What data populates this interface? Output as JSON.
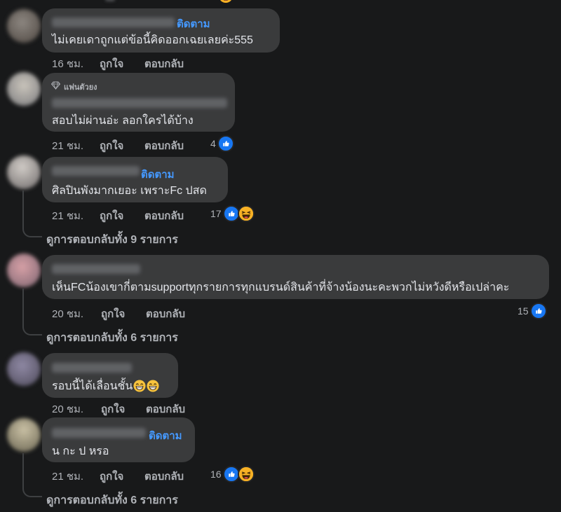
{
  "comments": [
    {
      "text": "ไม่เคยเดาถูกแต่ข้อนี้คิดออกเฉยเลยค่ะ555",
      "follow": "ติดตาม",
      "time": "16 ชม.",
      "like": "ถูกใจ",
      "reply": "ตอบกลับ"
    },
    {
      "badge": "แฟนตัวยง",
      "text": "สอบไม่ผ่านอ่ะ ลอกใครได้บ้าง",
      "time": "21 ชม.",
      "like": "ถูกใจ",
      "reply": "ตอบกลับ",
      "reactions": "4"
    },
    {
      "text": "ศิลปินพังมากเยอะ เพราะFc ปสด",
      "follow": "ติดตาม",
      "time": "21 ชม.",
      "like": "ถูกใจ",
      "reply": "ตอบกลับ",
      "reactions": "17",
      "view_replies": "ดูการตอบกลับทั้ง 9 รายการ"
    },
    {
      "text": "เห็นFCน้องเขากี่ตามsupportทุกรายการทุกแบรนด์สินค้าที่จ้างน้องนะคะพวกไม่หวังดีหรือเปล่าคะ",
      "time": "20 ชม.",
      "like": "ถูกใจ",
      "reply": "ตอบกลับ",
      "reactions": "15",
      "view_replies": "ดูการตอบกลับทั้ง 6 รายการ"
    },
    {
      "text": "รอบนี้ได้เลื่อนชั้น",
      "time": "20 ชม.",
      "like": "ถูกใจ",
      "reply": "ตอบกลับ"
    },
    {
      "text": "น กะ ป หรอ",
      "follow": "ติดตาม",
      "time": "21 ชม.",
      "like": "ถูกใจ",
      "reply": "ตอบกลับ",
      "reactions": "16",
      "view_replies": "ดูการตอบกลับทั้ง 6 รายการ"
    }
  ],
  "icons": {
    "like": "like-reaction-icon",
    "haha": "haha-reaction-icon",
    "grin": "grinning-emoji-icon",
    "badge": "diamond-badge-icon"
  },
  "colors": {
    "background": "#18191a",
    "bubble": "#3a3b3c",
    "follow": "#4599ff",
    "like": "#1877f2"
  }
}
